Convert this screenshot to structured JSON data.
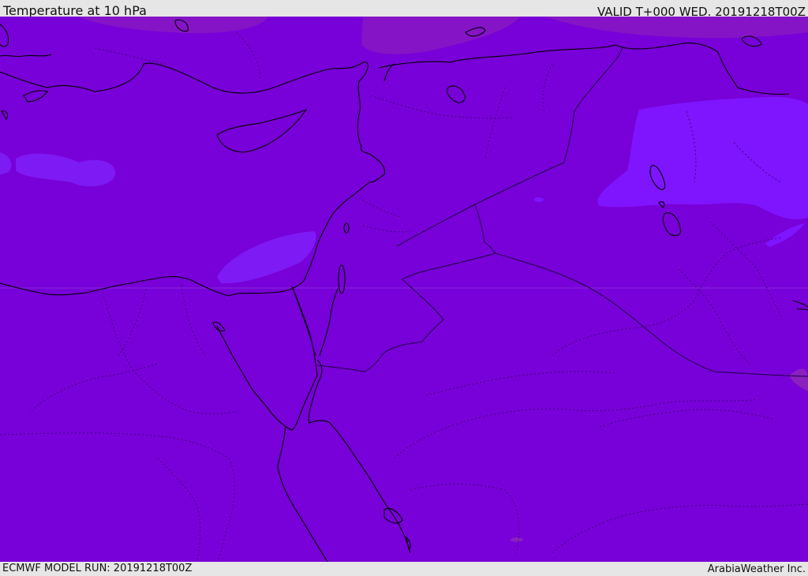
{
  "header": {
    "title": "Temperature at 10 hPa",
    "valid_time": "VALID T+000 WED. 20191218T00Z"
  },
  "footer": {
    "model_run": "ECMWF MODEL RUN: 20191218T00Z",
    "credit": "ArabiaWeather Inc."
  },
  "map": {
    "region": "Eastern Mediterranean and Middle East",
    "field": "temperature",
    "colors": {
      "base_fill": "#7800d8",
      "warm_patch": "#8a0fd0",
      "cool_patch": "#7b10f0",
      "coast_line": "#000000",
      "border_line": "#1a0040"
    }
  }
}
